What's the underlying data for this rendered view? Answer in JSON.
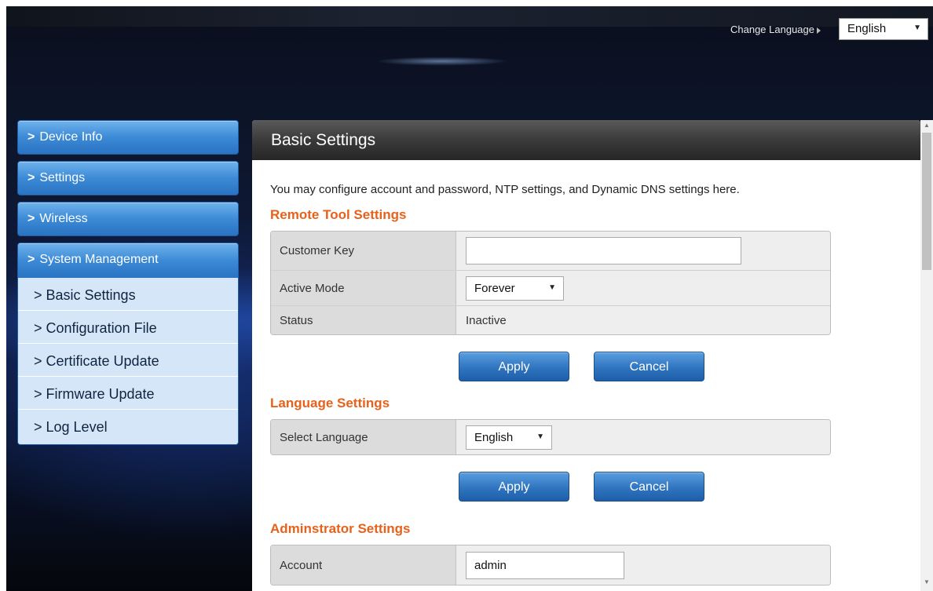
{
  "header": {
    "change_language_label": "Change Language",
    "language_selected": "English"
  },
  "sidebar": {
    "items": [
      {
        "label": "Device Info"
      },
      {
        "label": "Settings"
      },
      {
        "label": "Wireless"
      },
      {
        "label": "System Management"
      }
    ],
    "sub_items": [
      {
        "label": "Basic Settings"
      },
      {
        "label": "Configuration File"
      },
      {
        "label": "Certificate Update"
      },
      {
        "label": "Firmware Update"
      },
      {
        "label": "Log Level"
      }
    ]
  },
  "panel": {
    "title": "Basic Settings",
    "intro": "You may configure account and password, NTP settings, and Dynamic DNS settings here.",
    "remote_tool": {
      "title": "Remote Tool Settings",
      "customer_key_label": "Customer Key",
      "customer_key_value": "",
      "active_mode_label": "Active Mode",
      "active_mode_value": "Forever",
      "status_label": "Status",
      "status_value": "Inactive",
      "apply_label": "Apply",
      "cancel_label": "Cancel"
    },
    "language": {
      "title": "Language Settings",
      "select_language_label": "Select Language",
      "select_language_value": "English",
      "apply_label": "Apply",
      "cancel_label": "Cancel"
    },
    "admin": {
      "title": "Adminstrator Settings",
      "account_label": "Account",
      "account_value": "admin"
    }
  },
  "icons": {
    "chevron": "chevron-right-icon",
    "dropdown": "dropdown-caret-icon"
  }
}
